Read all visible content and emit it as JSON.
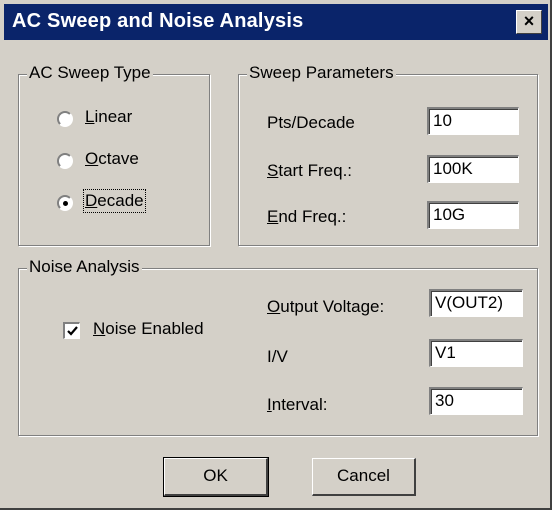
{
  "window": {
    "title": "AC Sweep and Noise Analysis",
    "close_label": "×"
  },
  "ac_sweep_type": {
    "legend": "AC Sweep Type",
    "options": [
      {
        "label": "Linear",
        "selected": false
      },
      {
        "label": "Octave",
        "selected": false
      },
      {
        "label": "Decade",
        "selected": true
      }
    ]
  },
  "sweep_parameters": {
    "legend": "Sweep Parameters",
    "pts_label": "Pts/Decade",
    "pts_value": "10",
    "start_label": "Start Freq.:",
    "start_value": "100K",
    "end_label": "End Freq.:",
    "end_value": "10G"
  },
  "noise_analysis": {
    "legend": "Noise Analysis",
    "enabled_label": "Noise Enabled",
    "enabled": true,
    "output_label": "Output Voltage:",
    "output_value": "V(OUT2)",
    "iv_label": "I/V",
    "iv_value": "V1",
    "interval_label": "Interval:",
    "interval_value": "30"
  },
  "buttons": {
    "ok": "OK",
    "cancel": "Cancel"
  }
}
